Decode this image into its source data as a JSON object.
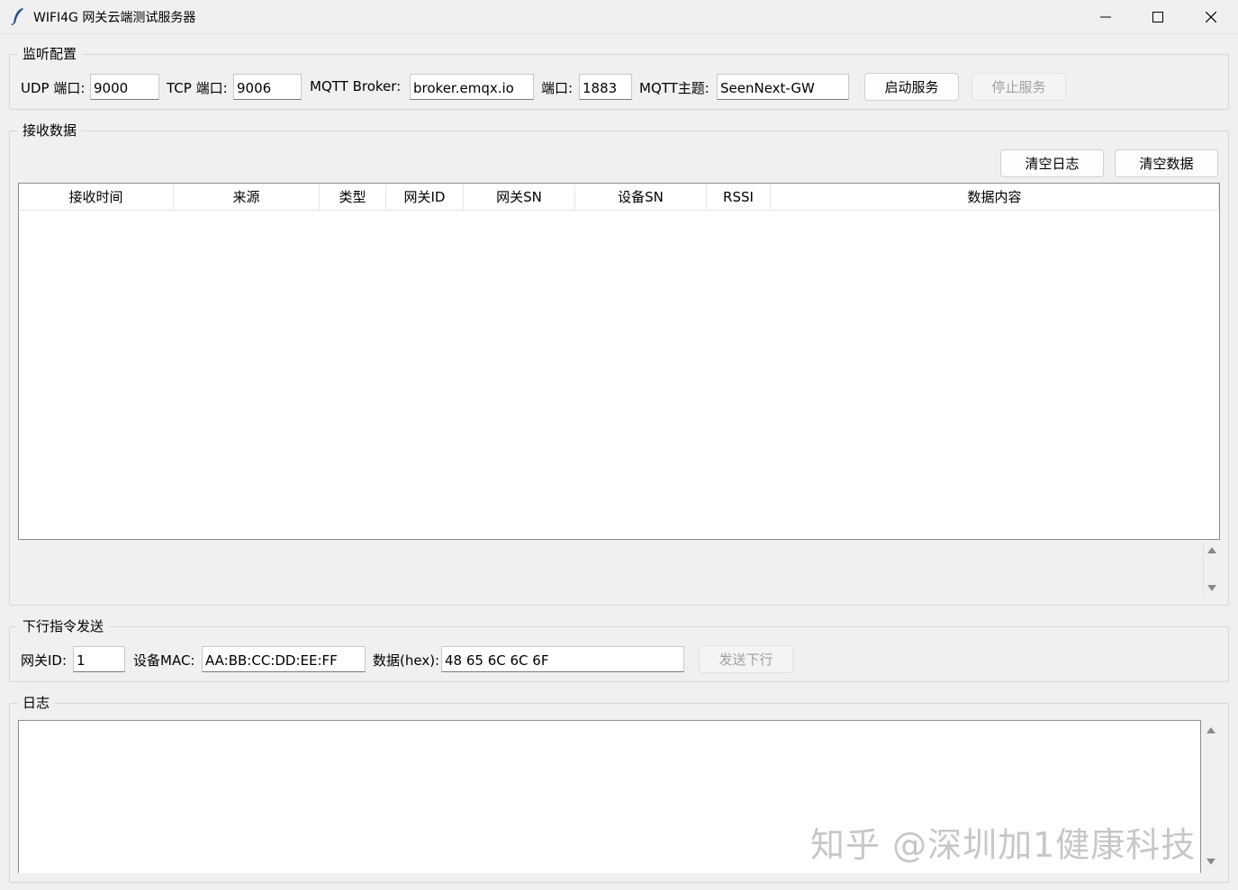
{
  "window": {
    "title": "WIFI4G 网关云端测试服务器",
    "controls": {
      "minimize": "minimize",
      "maximize": "maximize",
      "close": "close"
    }
  },
  "listen": {
    "legend": "监听配置",
    "udp_label": "UDP 端口:",
    "udp_value": "9000",
    "tcp_label": "TCP 端口:",
    "tcp_value": "9006",
    "broker_label": "MQTT Broker:",
    "broker_value": "broker.emqx.io",
    "port_label": "端口:",
    "port_value": "1883",
    "topic_label": "MQTT主题:",
    "topic_value": "SeenNext-GW",
    "start_btn": "启动服务",
    "stop_btn": "停止服务"
  },
  "receive": {
    "legend": "接收数据",
    "clear_log_btn": "清空日志",
    "clear_data_btn": "清空数据",
    "columns": [
      "接收时间",
      "来源",
      "类型",
      "网关ID",
      "网关SN",
      "设备SN",
      "RSSI",
      "数据内容"
    ]
  },
  "downlink": {
    "legend": "下行指令发送",
    "gw_label": "网关ID:",
    "gw_value": "1",
    "mac_label": "设备MAC:",
    "mac_value": "AA:BB:CC:DD:EE:FF",
    "data_label": "数据(hex):",
    "data_value": "48 65 6C 6C 6F",
    "send_btn": "发送下行"
  },
  "log": {
    "legend": "日志"
  },
  "watermark": "知乎 @深圳加1健康科技",
  "colors": {
    "window_bg": "#f0f0f0",
    "disabled_text": "#a0a0a0",
    "border": "#8c8c8c"
  }
}
